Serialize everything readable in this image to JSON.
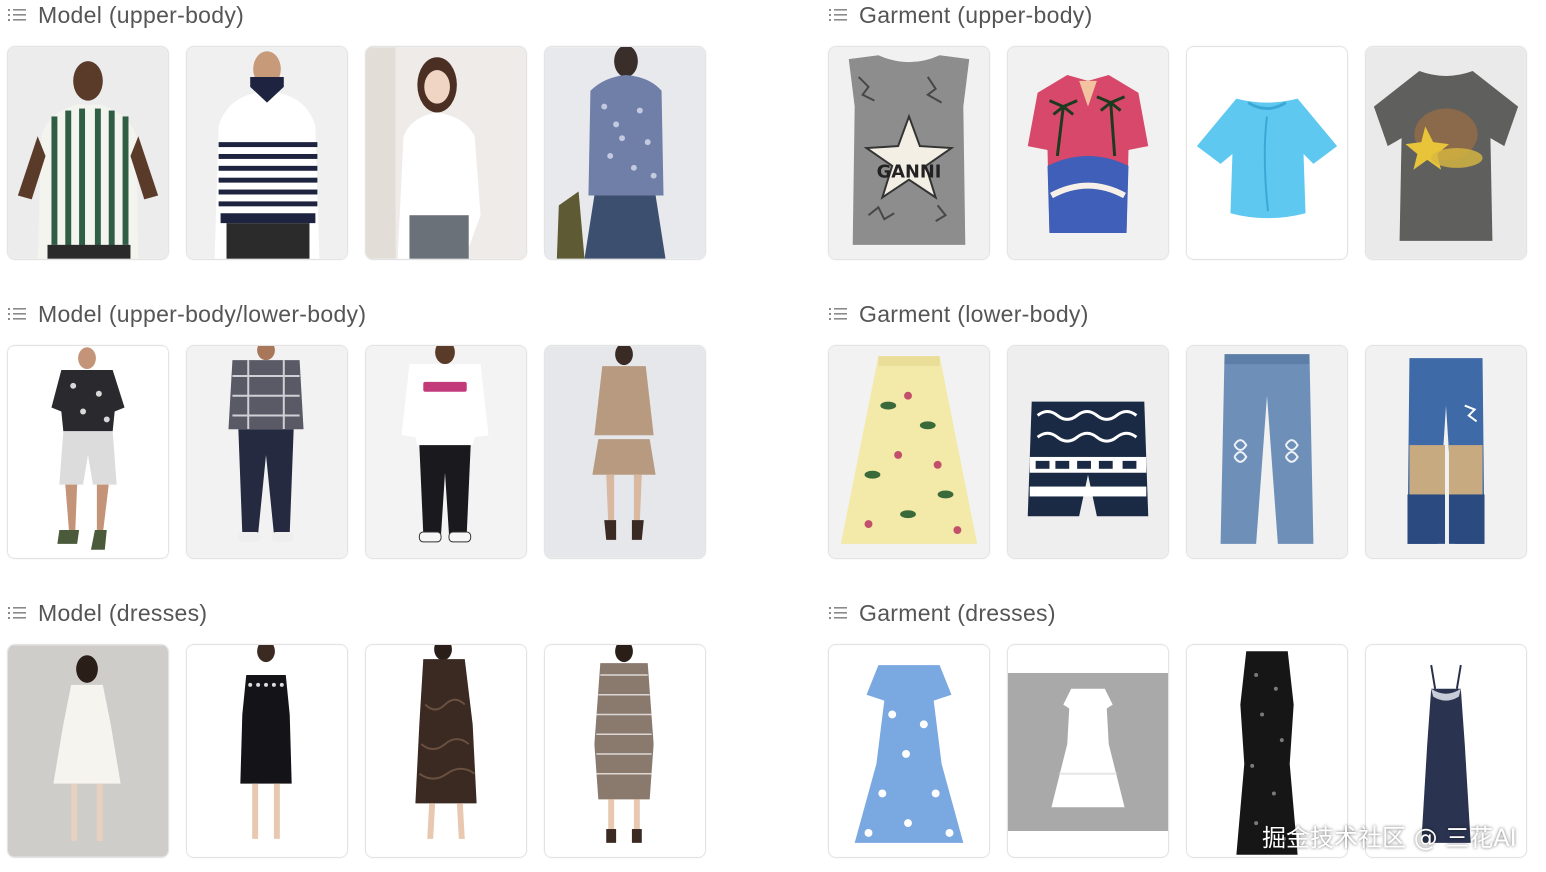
{
  "sections": {
    "model_upper": {
      "title": "Model (upper-body)"
    },
    "garment_upper": {
      "title": "Garment (upper-body)"
    },
    "model_upper_lower": {
      "title": "Model (upper-body/lower-body)"
    },
    "garment_lower": {
      "title": "Garment (lower-body)"
    },
    "model_dresses": {
      "title": "Model (dresses)"
    },
    "garment_dresses": {
      "title": "Garment (dresses)"
    }
  },
  "garment_text": {
    "ganni": "GANNI"
  },
  "watermark": "掘金技术社区 @ 三花AI",
  "colors": {
    "card_bg": "#f6f6f6",
    "card_border": "#e3e3e3",
    "title_text": "#555555",
    "icon": "#8a8a8a"
  },
  "icons": {
    "section_icon": "list-icon"
  }
}
